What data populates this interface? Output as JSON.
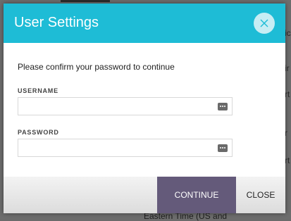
{
  "background": {
    "bottom_text": "Eastern Time (US and",
    "right_fragments": [
      "ici",
      "ir",
      "rt",
      "r",
      "rt"
    ]
  },
  "dialog": {
    "title": "User Settings",
    "close_icon": "close-icon",
    "instruction": "Please confirm your password to continue",
    "username": {
      "label": "USERNAME",
      "value": "",
      "placeholder": ""
    },
    "password": {
      "label": "PASSWORD",
      "value": "",
      "placeholder": ""
    },
    "continue_label": "CONTINUE",
    "close_label": "CLOSE"
  },
  "colors": {
    "header": "#1ebcd6",
    "primary_button": "#645a7a",
    "overlay": "#6b6b6b"
  }
}
